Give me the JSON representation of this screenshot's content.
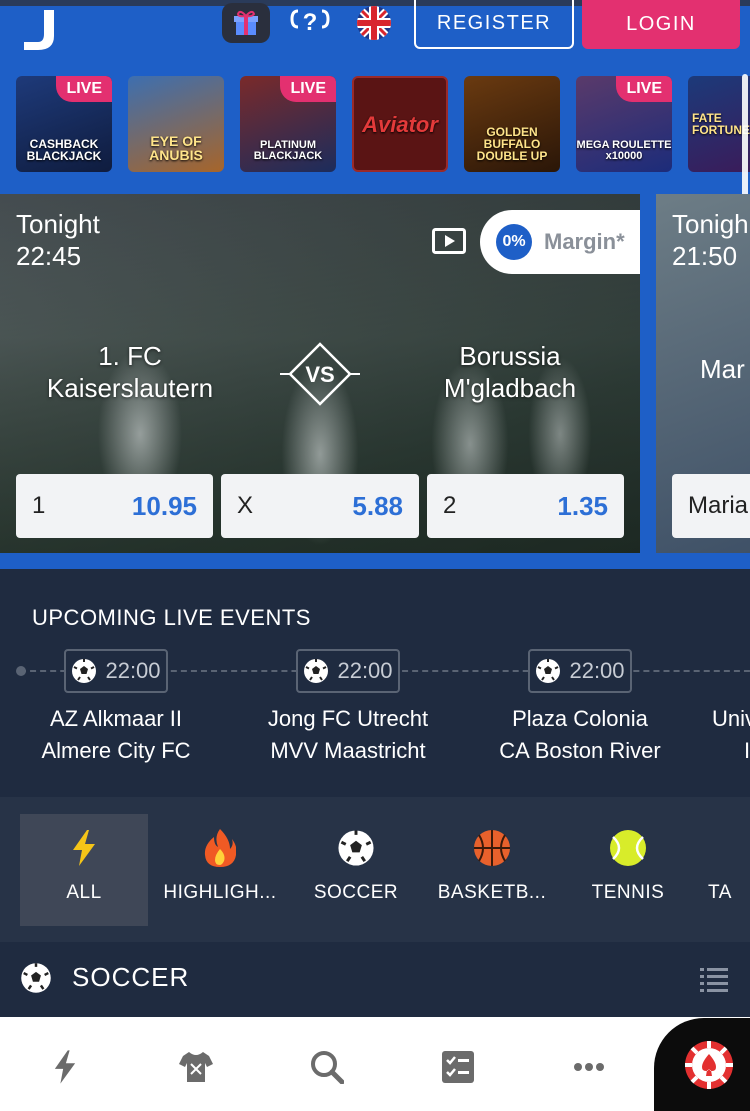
{
  "header": {
    "register_label": "REGISTER",
    "login_label": "LOGIN"
  },
  "games": [
    {
      "name": "CASHBACK BLACKJACK",
      "live": "LIVE"
    },
    {
      "name": "EYE OF ANUBIS",
      "live": ""
    },
    {
      "name": "PLATINUM BLACKJACK",
      "live": "LIVE"
    },
    {
      "name": "Aviator",
      "live": ""
    },
    {
      "name": "GOLDEN BUFFALO DOUBLE UP",
      "live": ""
    },
    {
      "name": "MEGA ROULETTE x10000",
      "live": "LIVE"
    },
    {
      "name": "FATE FORTUNE",
      "live": ""
    }
  ],
  "match": {
    "day": "Tonight",
    "time": "22:45",
    "margin_pct": "0%",
    "margin_label": "Margin*",
    "home": "1. FC Kaiserslautern",
    "home_line1": "1. FC",
    "home_line2": "Kaiserslautern",
    "vs": "VS",
    "away_line1": "Borussia",
    "away_line2": "M'gladbach",
    "odds": [
      {
        "label": "1",
        "value": "10.95"
      },
      {
        "label": "X",
        "value": "5.88"
      },
      {
        "label": "2",
        "value": "1.35"
      }
    ]
  },
  "match2": {
    "day": "Tonigh",
    "time": "21:50",
    "team": "Mar",
    "odd_label": "Maria"
  },
  "upcoming": {
    "title": "UPCOMING LIVE EVENTS",
    "events": [
      {
        "time": "22:00",
        "home": "AZ Alkmaar II",
        "away": "Almere City FC"
      },
      {
        "time": "22:00",
        "home": "Jong FC Utrecht",
        "away": "MVV Maastricht"
      },
      {
        "time": "22:00",
        "home": "Plaza Colonia",
        "away": "CA Boston River"
      },
      {
        "time": "",
        "home": "Univ",
        "away": "I"
      }
    ]
  },
  "sports": [
    {
      "label": "ALL",
      "icon": "lightning-icon"
    },
    {
      "label": "HIGHLIGH...",
      "icon": "flame-icon"
    },
    {
      "label": "SOCCER",
      "icon": "soccer-ball-icon"
    },
    {
      "label": "BASKETB...",
      "icon": "basketball-icon"
    },
    {
      "label": "TENNIS",
      "icon": "tennis-ball-icon"
    },
    {
      "label": "TA",
      "icon": ""
    }
  ],
  "section": {
    "title": "SOCCER"
  },
  "colors": {
    "brand_blue": "#1e5fc7",
    "login_pink": "#e33070",
    "odds_blue": "#2d6fd6",
    "dark_bg": "#1f2b40"
  }
}
